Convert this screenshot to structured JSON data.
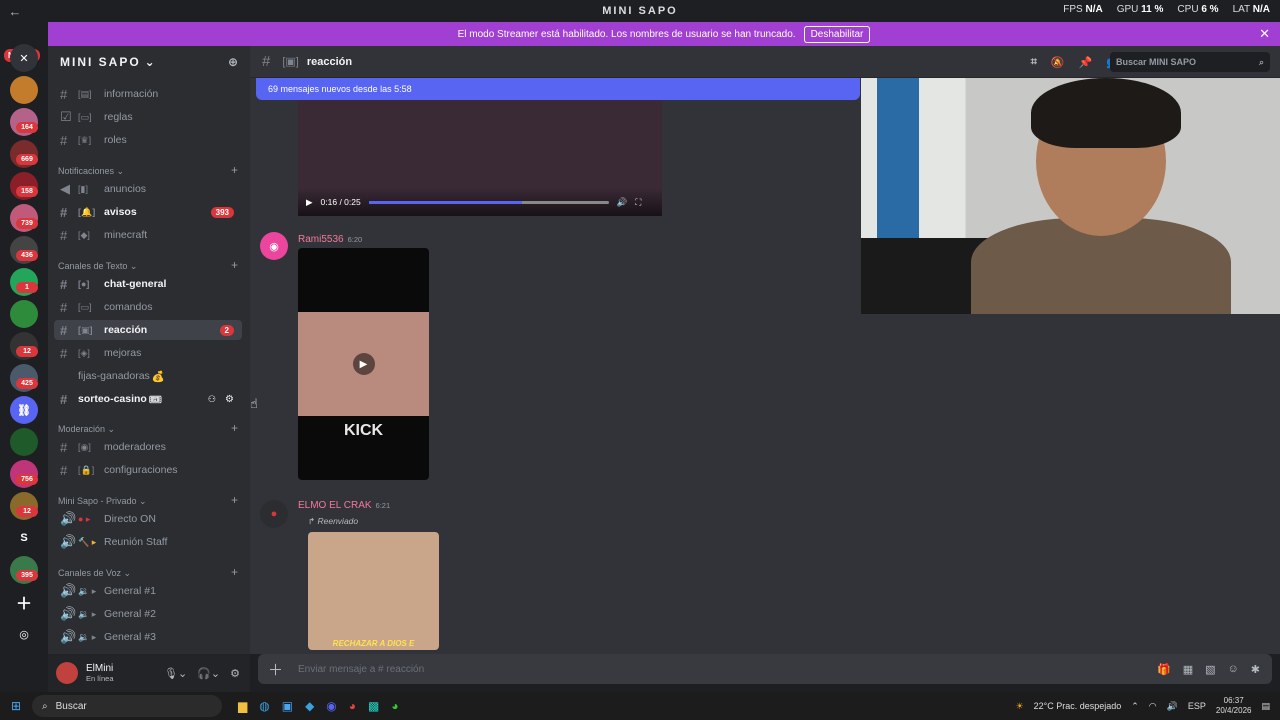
{
  "titlebar": {
    "back": "←",
    "title": "MINI SAPO",
    "fps_label": "FPS",
    "fps": "N/A",
    "gpu_label": "GPU",
    "gpu": "11 %",
    "cpu_label": "CPU",
    "cpu": "6 %",
    "lat_label": "LAT",
    "lat": "N/A"
  },
  "guilds": {
    "nuevo": "NUEVO",
    "badges": [
      "164",
      "669",
      "158",
      "739",
      "436",
      "1",
      "12",
      "425",
      "756",
      "12",
      "395"
    ],
    "letter_s": "S"
  },
  "streamer": {
    "message": "El modo Streamer está habilitado. Los nombres de usuario se han truncado.",
    "button": "Deshabilitar",
    "close": "✕"
  },
  "server": {
    "name": "MINI SAPO",
    "chevron": "⌄"
  },
  "channels": {
    "informacion": "información",
    "reglas": "reglas",
    "roles": "roles",
    "cat_notificaciones": "Notificaciones",
    "anuncios": "anuncios",
    "avisos": "avisos",
    "avisos_badge": "393",
    "minecraft": "minecraft",
    "cat_texto": "Canales de Texto",
    "chat_general": "chat-general",
    "comandos": "comandos",
    "reaccion": "reacción",
    "reaccion_badge": "2",
    "mejoras": "mejoras",
    "fijas": "fijas-ganadoras",
    "sorteo": "sorteo-casino",
    "cat_moderacion": "Moderación",
    "moderadores": "moderadores",
    "configuraciones": "configuraciones",
    "cat_privado": "Mini Sapo - Privado",
    "directo": "Directo ON",
    "reunion": "Reunión Staff",
    "cat_voz": "Canales de Voz",
    "general1": "General #1",
    "general2": "General #2",
    "general3": "General #3"
  },
  "user": {
    "name": "ElMini",
    "status": "En línea"
  },
  "chanbar": {
    "name": "reacción",
    "search_placeholder": "Buscar MINI SAPO"
  },
  "chat": {
    "new_messages": "69 mensajes nuevos desde las 5:58",
    "video_time": "0:16 / 0:25",
    "video_progress": 0.64,
    "msg1_author": "Rami5536",
    "msg1_time": "6:20",
    "kick": "KICK",
    "msg2_author": "ELMO EL CRAK",
    "msg2_time": "6:21",
    "forwarded": "Reenviado",
    "img_caption": "RECHAZAR A DIOS E"
  },
  "composer": {
    "placeholder": "Enviar mensaje a # reacción"
  },
  "taskbar": {
    "search": "Buscar",
    "weather": "22°C  Prac. despejado",
    "lang": "ESP",
    "time": "06:37",
    "date": "20/4/2026"
  }
}
